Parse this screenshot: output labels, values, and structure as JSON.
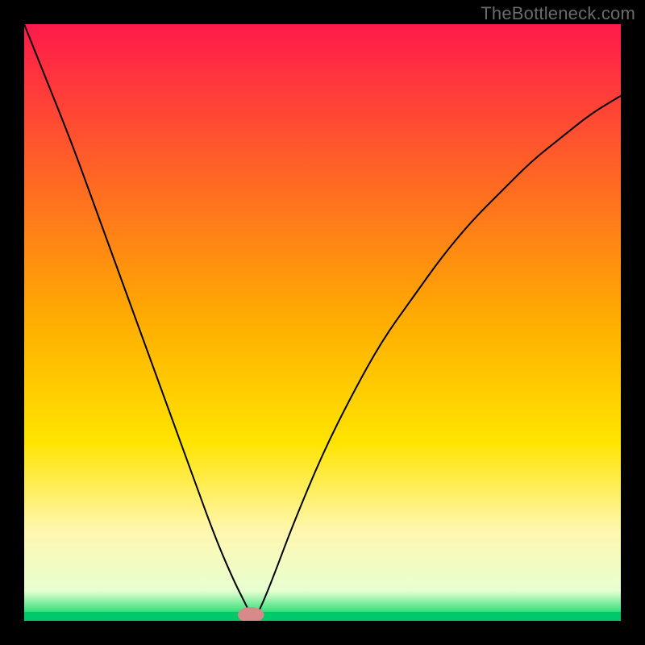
{
  "watermark": "TheBottleneck.com",
  "chart_data": {
    "type": "line",
    "title": "",
    "xlabel": "",
    "ylabel": "",
    "xlim": [
      0,
      100
    ],
    "ylim": [
      0,
      100
    ],
    "background_gradient": {
      "stops": [
        {
          "offset": 0.0,
          "color": "#ff1a4b"
        },
        {
          "offset": 0.5,
          "color": "#ffae00"
        },
        {
          "offset": 0.7,
          "color": "#ffe400"
        },
        {
          "offset": 0.85,
          "color": "#fff7b0"
        },
        {
          "offset": 0.95,
          "color": "#e7ffd0"
        },
        {
          "offset": 0.985,
          "color": "#33e07a"
        },
        {
          "offset": 1.0,
          "color": "#00c96b"
        }
      ]
    },
    "baseline_band": {
      "y_top": 98.5,
      "y_bottom": 100,
      "color": "#00c96b"
    },
    "marker": {
      "x": 38,
      "y": 99,
      "rx": 2.2,
      "ry": 1.3,
      "color": "#d88a8a"
    },
    "series": [
      {
        "name": "curve",
        "color": "#000000",
        "stroke_width": 2,
        "x": [
          0,
          4,
          8,
          12,
          16,
          20,
          24,
          28,
          32,
          35,
          37,
          38,
          39,
          40,
          42,
          45,
          50,
          55,
          60,
          65,
          70,
          75,
          80,
          85,
          90,
          95,
          100
        ],
        "y": [
          0,
          10,
          20,
          31,
          42,
          53,
          64,
          75,
          86,
          93,
          97,
          99,
          99,
          97,
          92,
          84,
          72,
          62,
          53,
          46,
          39,
          33,
          28,
          23,
          19,
          15,
          12
        ]
      }
    ],
    "annotations": []
  }
}
